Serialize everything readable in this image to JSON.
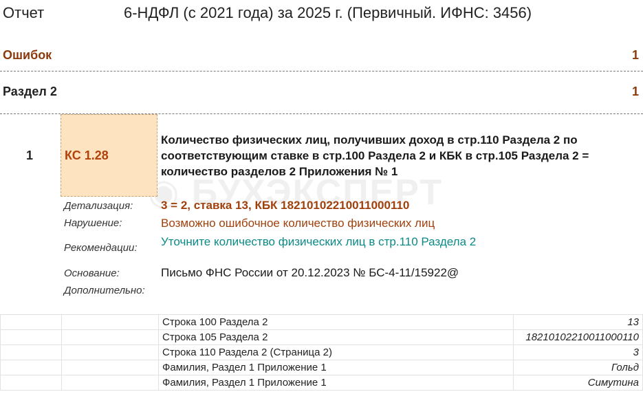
{
  "header": {
    "report_label": "Отчет",
    "report_title": "6-НДФЛ (с 2021 года) за 2025 г. (Первичный. ИФНС: 3456)"
  },
  "errors": {
    "label": "Ошибок",
    "count": "1"
  },
  "section": {
    "label": "Раздел 2",
    "count": "1"
  },
  "check": {
    "number": "1",
    "code": "КС 1.28",
    "description": "Количество физических лиц, получивших доход в стр.110 Раздела 2 по соответствующим ставке в стр.100 Раздела 2 и КБК в стр.105 Раздела 2 = количество разделов 2 Приложения № 1",
    "detail_label": "Детализация:",
    "detail_value": "3 = 2, ставка 13, КБК 18210102210011000110",
    "violation_label": "Нарушение:",
    "violation_value": "Возможно ошибочное количество физических лиц",
    "recommend_label": "Рекомендации:",
    "recommend_value": "Уточните количество физических лиц в стр.110 Раздела 2",
    "basis_label": "Основание:",
    "basis_value": "Письмо ФНС России от 20.12.2023 № БС-4-11/15922@",
    "extra_label": "Дополнительно:"
  },
  "watermark": "БУХЭКСПЕРТ",
  "table": {
    "rows": [
      {
        "field": "Строка 100 Раздела 2",
        "value": "13"
      },
      {
        "field": "Строка 105 Раздела 2",
        "value": "18210102210011000110"
      },
      {
        "field": "Строка 110 Раздела 2 (Страница 2)",
        "value": "3"
      },
      {
        "field": "Фамилия, Раздел 1 Приложение 1",
        "value": "Гольд"
      },
      {
        "field": "Фамилия, Раздел 1 Приложение 1",
        "value": "Симутина"
      }
    ]
  }
}
